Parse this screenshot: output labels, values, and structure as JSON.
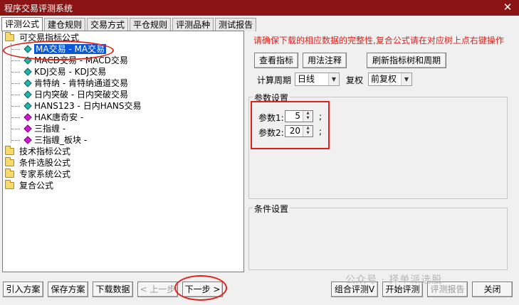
{
  "window": {
    "title": "程序交易评测系统",
    "close_glyph": "✕"
  },
  "tabs": [
    "评测公式",
    "建仓规则",
    "交易方式",
    "平仓规则",
    "评测品种",
    "测试报告"
  ],
  "tree": {
    "folders": [
      "可交易指标公式",
      "技术指标公式",
      "条件选股公式",
      "专家系统公式",
      "复合公式"
    ],
    "items": [
      "MA交易 - MA交易",
      "MACD交易 - MACD交易",
      "KDJ交易 - KDJ交易",
      "肯特纳 - 肯特纳通道交易",
      "日内突破 - 日内突破交易",
      "HANS123 - 日内HANS交易",
      "HAK唐奇安 -",
      "三指缠 -",
      "三指缠_板块 -"
    ]
  },
  "notice": "请确保下载的相应数据的完整性,复合公式请在对应树上点右键操作",
  "buttons": {
    "view_indicator": "查看指标",
    "usage_notes": "用法注释",
    "refresh_tree": "刷新指标树和周期"
  },
  "period": {
    "label": "计算周期",
    "value": "日线"
  },
  "adjust": {
    "label": "复权",
    "value": "前复权"
  },
  "params": {
    "title": "参数设置",
    "p1_label": "参数1:",
    "p1_value": "5",
    "p2_label": "参数2:",
    "p2_value": "20",
    "suffix": ";"
  },
  "conditions": {
    "title": "条件设置"
  },
  "footer": {
    "import_scheme": "引入方案",
    "save_scheme": "保存方案",
    "download_data": "下载数据",
    "prev_step": "< 上一步",
    "next_step": "下一步 >",
    "combo_eval": "组合评测V",
    "start_eval": "开始评测",
    "eval_report": "评测报告",
    "close": "关闭"
  },
  "watermark": "公众号 · 择单派选股",
  "colors": {
    "titlebar": "#8b1414",
    "highlight": "#e0201a",
    "selection": "#0a58d6"
  }
}
